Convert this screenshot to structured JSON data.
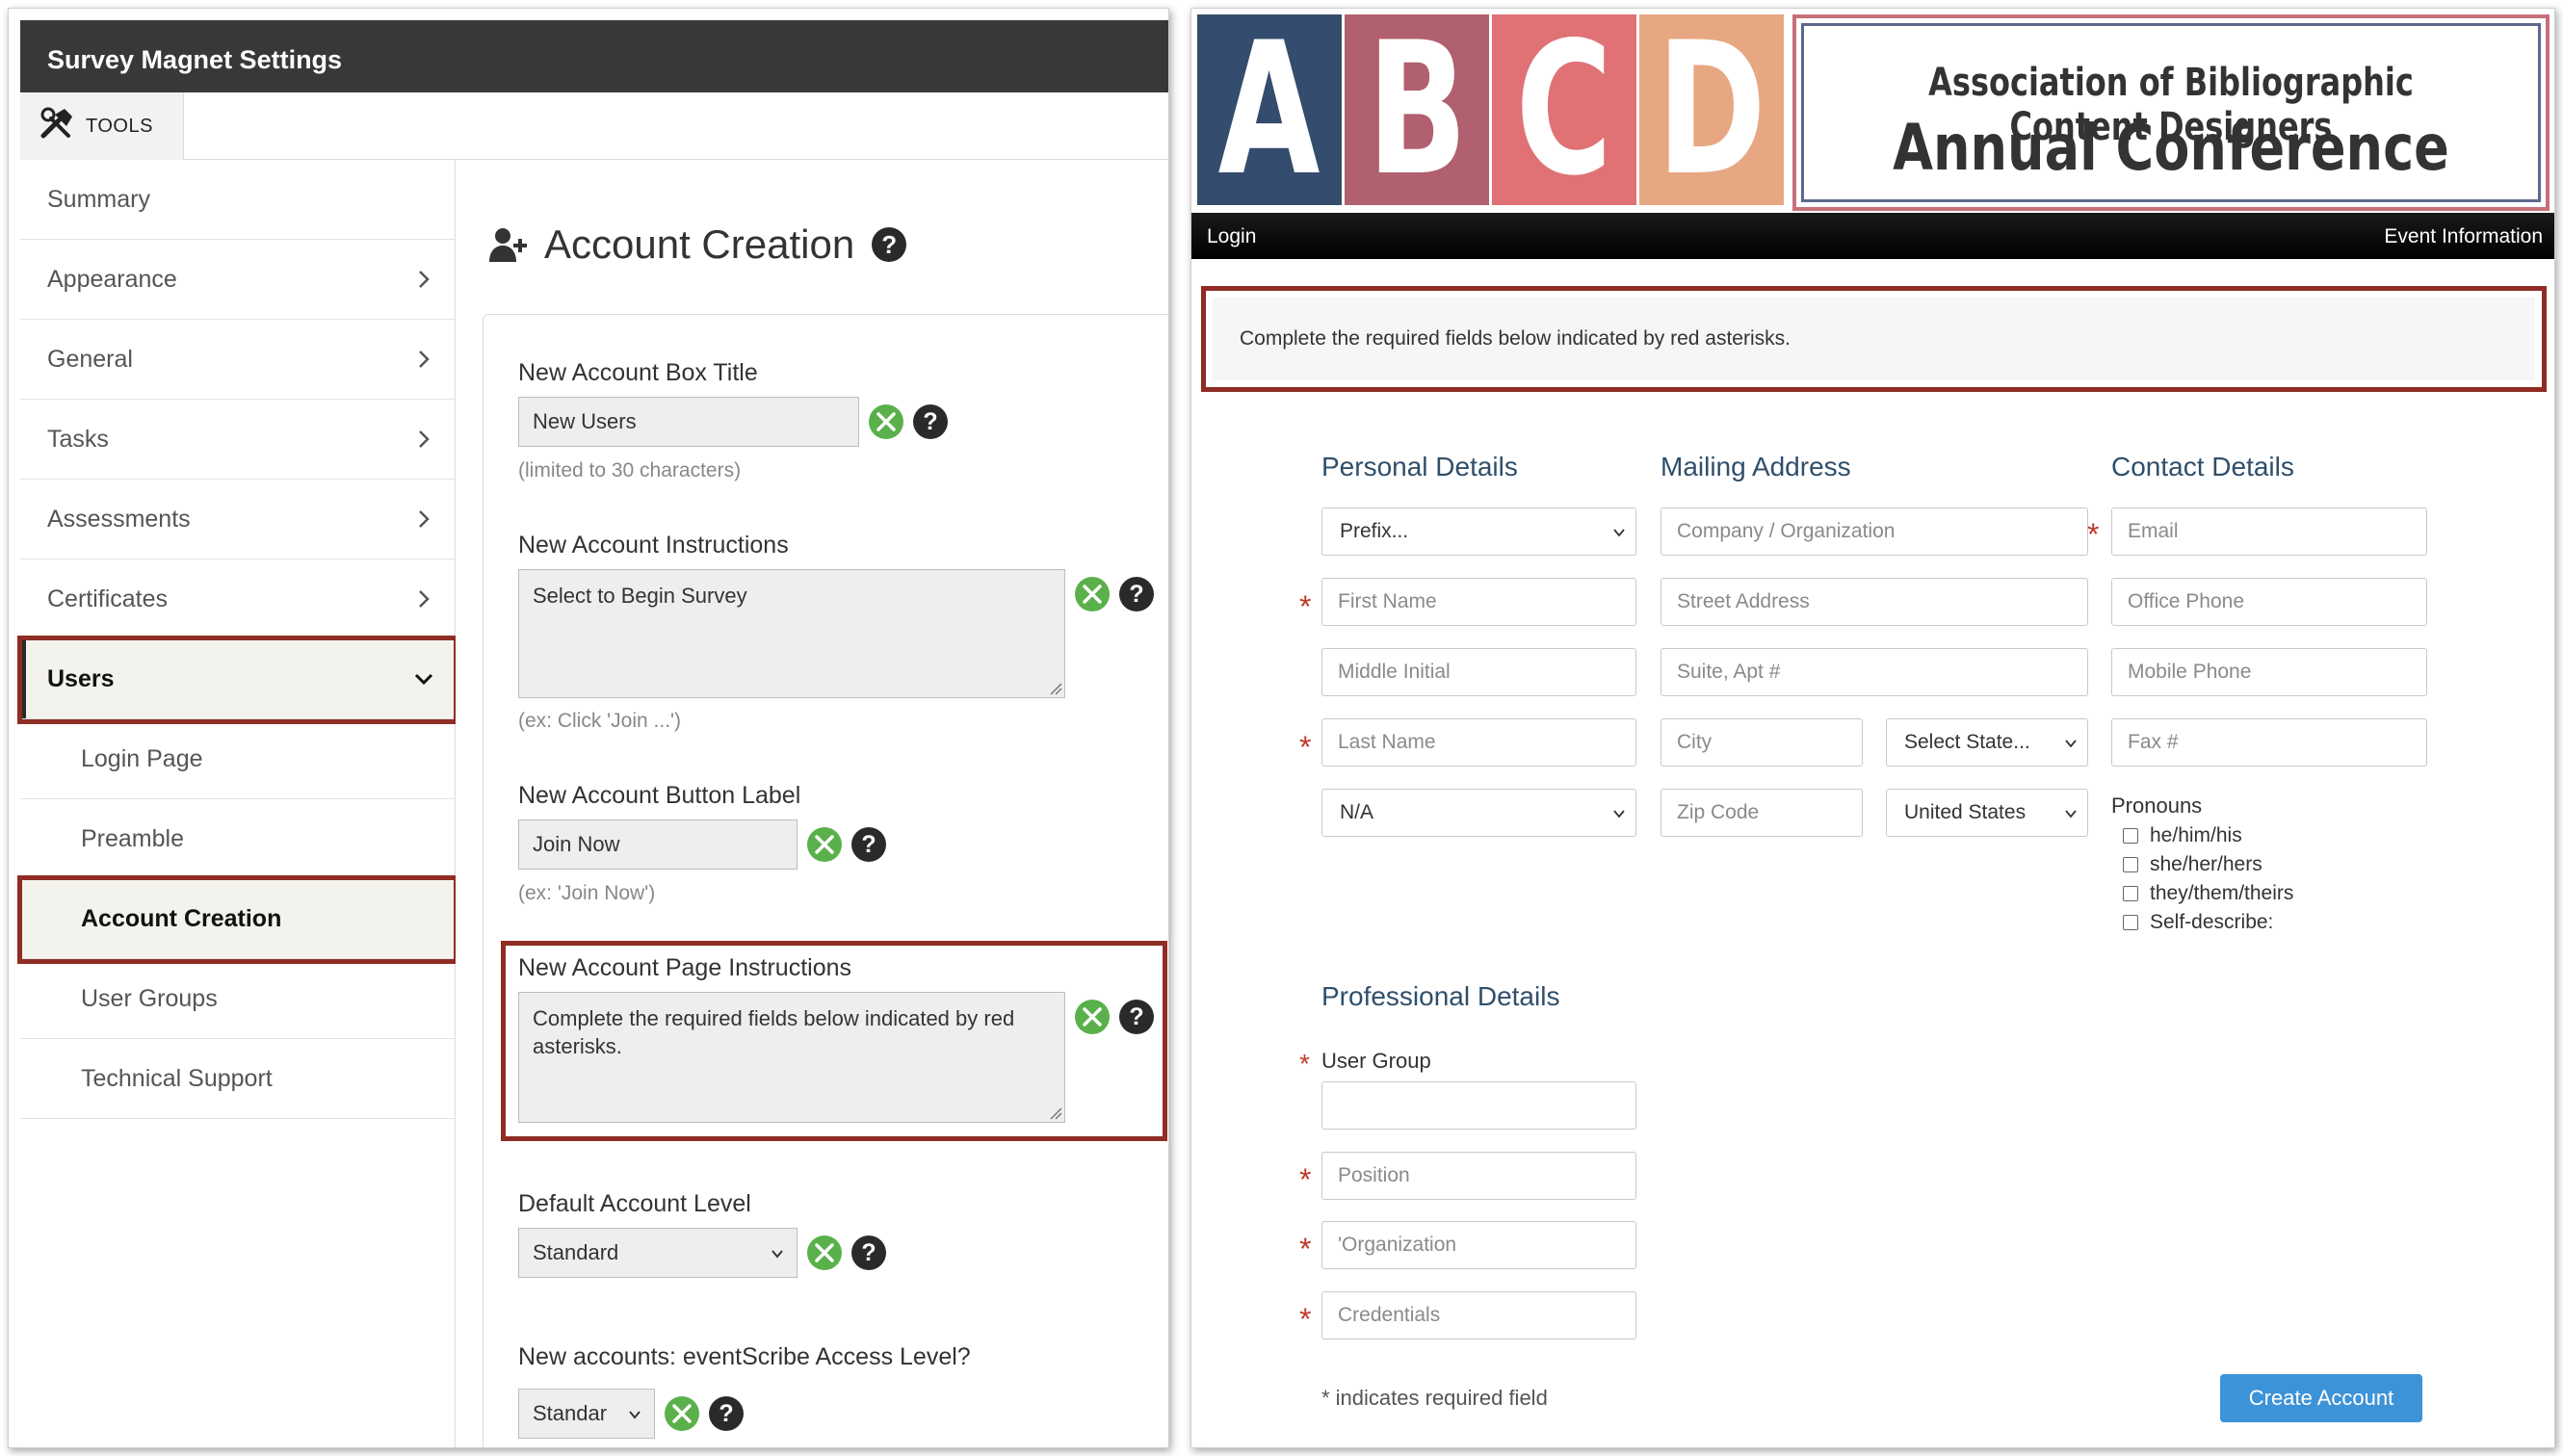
{
  "settings": {
    "app_title": "Survey Magnet Settings",
    "tools_label": "TOOLS",
    "sidebar": {
      "items": [
        {
          "label": "Summary"
        },
        {
          "label": "Appearance"
        },
        {
          "label": "General"
        },
        {
          "label": "Tasks"
        },
        {
          "label": "Assessments"
        },
        {
          "label": "Certificates"
        },
        {
          "label": "Users"
        }
      ],
      "sub_items": [
        {
          "label": "Login Page"
        },
        {
          "label": "Preamble"
        },
        {
          "label": "Account Creation"
        },
        {
          "label": "User Groups"
        },
        {
          "label": "Technical Support"
        }
      ]
    },
    "page_title": "Account Creation",
    "fields": {
      "box_title": {
        "label": "New Account Box Title",
        "value": "New Users",
        "hint": "(limited to 30 characters)"
      },
      "instructions": {
        "label": "New Account Instructions",
        "value": "Select to Begin Survey",
        "hint": "(ex: Click 'Join ...')"
      },
      "button_label": {
        "label": "New Account Button Label",
        "value": "Join Now",
        "hint": "(ex: 'Join Now')"
      },
      "page_instructions": {
        "label": "New Account Page Instructions",
        "value": "Complete the required fields below indicated by red asterisks."
      },
      "default_level": {
        "label": "Default Account Level",
        "value": "Standard"
      },
      "eventscribe_level": {
        "label": "New accounts: eventScribe Access Level?",
        "value": "Standar"
      }
    },
    "help_glyph": "?"
  },
  "preview": {
    "logo_letters": [
      "A",
      "B",
      "C",
      "D"
    ],
    "logo_colors": [
      "#344c6d",
      "#b0606e",
      "#e07276",
      "#e8a783"
    ],
    "org_name": "Association of Bibliographic Content Designers",
    "conference_title": "Annual Conference",
    "nav": {
      "login": "Login",
      "event_info": "Event Information"
    },
    "instructions": "Complete the required fields below indicated by red asterisks.",
    "sections": {
      "personal": "Personal Details",
      "mailing": "Mailing Address",
      "contact": "Contact Details",
      "professional": "Professional Details"
    },
    "personal": {
      "prefix": "Prefix...",
      "first_name": "First Name",
      "middle_initial": "Middle Initial",
      "last_name": "Last Name",
      "suffix": "N/A"
    },
    "mailing": {
      "company": "Company / Organization",
      "street": "Street Address",
      "suite": "Suite, Apt #",
      "city": "City",
      "state": "Select State...",
      "zip": "Zip Code",
      "country": "United States"
    },
    "contact": {
      "email": "Email",
      "office_phone": "Office Phone",
      "mobile_phone": "Mobile Phone",
      "fax": "Fax #"
    },
    "pronouns": {
      "label": "Pronouns",
      "options": [
        "he/him/his",
        "she/her/hers",
        "they/them/theirs",
        "Self-describe:"
      ]
    },
    "professional": {
      "user_group_label": "User Group",
      "user_group_value": "",
      "position": "Position",
      "organization": "'Organization",
      "credentials": "Credentials"
    },
    "required_note": "* indicates required field",
    "required_mark": "*",
    "create_button": "Create Account"
  }
}
